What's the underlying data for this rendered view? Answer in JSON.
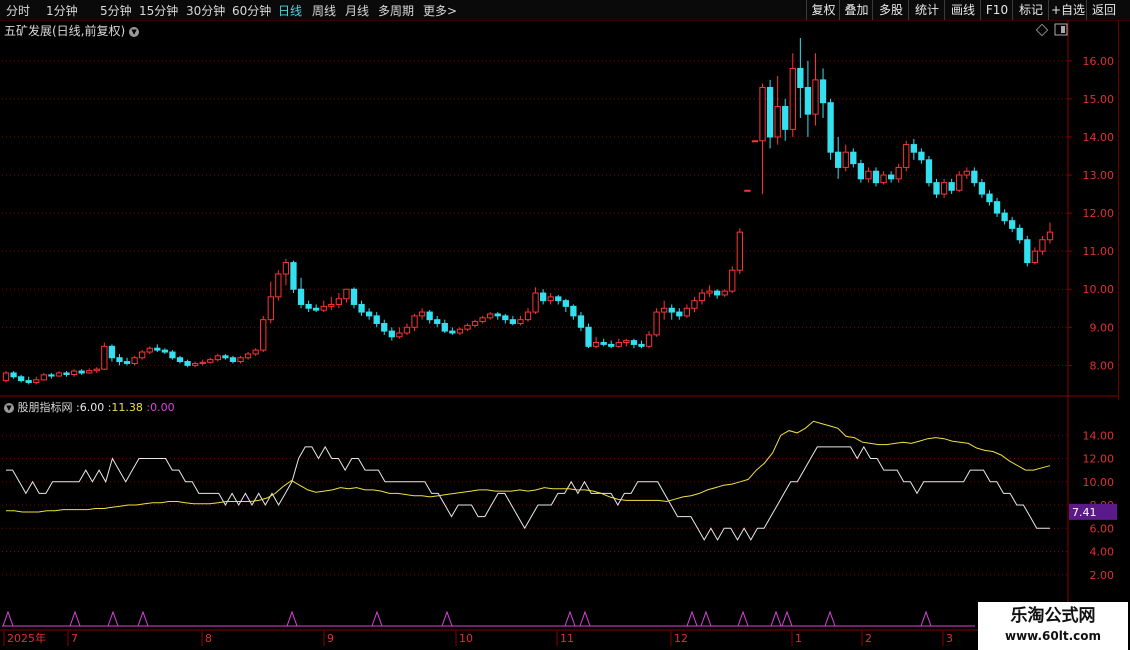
{
  "toolbar": {
    "periods": [
      {
        "label": "分时",
        "active": false
      },
      {
        "label": "1分钟",
        "active": false
      },
      {
        "label": "5分钟",
        "active": false
      },
      {
        "label": "15分钟",
        "active": false
      },
      {
        "label": "30分钟",
        "active": false
      },
      {
        "label": "60分钟",
        "active": false
      },
      {
        "label": "日线",
        "active": true
      },
      {
        "label": "周线",
        "active": false
      },
      {
        "label": "月线",
        "active": false
      },
      {
        "label": "多周期",
        "active": false
      },
      {
        "label": "更多",
        "active": false
      }
    ],
    "more_arrow": ">",
    "right_buttons": [
      "复权",
      "叠加",
      "多股",
      "统计",
      "画线",
      "F10",
      "标记",
      "+自选",
      "返回"
    ]
  },
  "chart_title": "五矿发展(日线,前复权)",
  "main_axis_labels": [
    "16.00",
    "15.00",
    "14.00",
    "13.00",
    "12.00",
    "11.00",
    "10.00",
    "9.00",
    "8.00"
  ],
  "indicator": {
    "name": "股朋指标网",
    "values": [
      ":6.00",
      ":11.38",
      ":0.00"
    ],
    "axis_labels": [
      "14.00",
      "12.00",
      "10.00",
      "8.00",
      "6.00",
      "4.00",
      "2.00"
    ],
    "current_marker": "7.41"
  },
  "date_axis": {
    "labels": [
      "2025年",
      "7",
      "8",
      "9",
      "10",
      "11",
      "12",
      "1",
      "2",
      "3"
    ]
  },
  "watermark": {
    "line1": "乐淘公式网",
    "line2": "www.60lt.com"
  },
  "colors": {
    "up": "#ff3333",
    "down": "#33e0f0",
    "yellow": "#f0e040",
    "white": "#e8e8e8",
    "magenta": "#e040e0",
    "grid": "#8a0000",
    "marker_bg": "#5a1a8a"
  },
  "chart_data": {
    "type": "line",
    "title": "五矿发展(日线,前复权)",
    "candles": [
      [
        7.6,
        7.8,
        7.55,
        7.85
      ],
      [
        7.8,
        7.7,
        7.65,
        7.85
      ],
      [
        7.7,
        7.6,
        7.55,
        7.75
      ],
      [
        7.6,
        7.55,
        7.5,
        7.7
      ],
      [
        7.55,
        7.62,
        7.5,
        7.7
      ],
      [
        7.62,
        7.75,
        7.6,
        7.8
      ],
      [
        7.75,
        7.72,
        7.65,
        7.8
      ],
      [
        7.72,
        7.8,
        7.7,
        7.85
      ],
      [
        7.8,
        7.76,
        7.7,
        7.85
      ],
      [
        7.76,
        7.85,
        7.7,
        7.9
      ],
      [
        7.85,
        7.8,
        7.75,
        7.9
      ],
      [
        7.8,
        7.86,
        7.78,
        7.92
      ],
      [
        7.86,
        7.9,
        7.8,
        7.95
      ],
      [
        7.9,
        8.5,
        7.88,
        8.6
      ],
      [
        8.5,
        8.2,
        8.1,
        8.55
      ],
      [
        8.2,
        8.1,
        8.0,
        8.3
      ],
      [
        8.1,
        8.05,
        8.0,
        8.2
      ],
      [
        8.05,
        8.2,
        8.0,
        8.25
      ],
      [
        8.2,
        8.35,
        8.15,
        8.4
      ],
      [
        8.35,
        8.45,
        8.3,
        8.5
      ],
      [
        8.45,
        8.4,
        8.35,
        8.55
      ],
      [
        8.4,
        8.35,
        8.3,
        8.45
      ],
      [
        8.35,
        8.2,
        8.15,
        8.4
      ],
      [
        8.2,
        8.1,
        8.05,
        8.25
      ],
      [
        8.1,
        8.0,
        7.95,
        8.15
      ],
      [
        8.0,
        8.05,
        7.95,
        8.1
      ],
      [
        8.05,
        8.08,
        8.0,
        8.15
      ],
      [
        8.08,
        8.15,
        8.05,
        8.2
      ],
      [
        8.15,
        8.25,
        8.1,
        8.3
      ],
      [
        8.25,
        8.2,
        8.15,
        8.3
      ],
      [
        8.2,
        8.1,
        8.05,
        8.25
      ],
      [
        8.1,
        8.2,
        8.05,
        8.25
      ],
      [
        8.2,
        8.3,
        8.15,
        8.35
      ],
      [
        8.3,
        8.4,
        8.25,
        8.45
      ],
      [
        8.4,
        9.2,
        8.35,
        9.3
      ],
      [
        9.2,
        9.8,
        9.1,
        10.2
      ],
      [
        9.8,
        10.4,
        9.7,
        10.5
      ],
      [
        10.4,
        10.7,
        10.1,
        10.8
      ],
      [
        10.7,
        10.0,
        9.9,
        10.75
      ],
      [
        10.0,
        9.6,
        9.5,
        10.3
      ],
      [
        9.6,
        9.5,
        9.4,
        9.7
      ],
      [
        9.5,
        9.45,
        9.4,
        9.6
      ],
      [
        9.45,
        9.55,
        9.4,
        9.7
      ],
      [
        9.55,
        9.6,
        9.45,
        9.8
      ],
      [
        9.6,
        9.75,
        9.5,
        9.9
      ],
      [
        9.75,
        10.0,
        9.65,
        10.0
      ],
      [
        10.0,
        9.6,
        9.5,
        10.05
      ],
      [
        9.6,
        9.4,
        9.3,
        9.7
      ],
      [
        9.4,
        9.3,
        9.2,
        9.5
      ],
      [
        9.3,
        9.1,
        9.0,
        9.4
      ],
      [
        9.1,
        8.9,
        8.8,
        9.2
      ],
      [
        8.9,
        8.75,
        8.65,
        9.0
      ],
      [
        8.75,
        8.85,
        8.7,
        9.0
      ],
      [
        8.85,
        9.0,
        8.8,
        9.1
      ],
      [
        9.0,
        9.3,
        8.9,
        9.35
      ],
      [
        9.3,
        9.4,
        9.2,
        9.5
      ],
      [
        9.4,
        9.2,
        9.1,
        9.45
      ],
      [
        9.2,
        9.1,
        9.0,
        9.3
      ],
      [
        9.1,
        8.9,
        8.85,
        9.2
      ],
      [
        8.9,
        8.85,
        8.8,
        9.0
      ],
      [
        8.85,
        8.95,
        8.8,
        9.0
      ],
      [
        8.95,
        9.05,
        8.9,
        9.1
      ],
      [
        9.05,
        9.15,
        9.0,
        9.2
      ],
      [
        9.15,
        9.25,
        9.1,
        9.3
      ],
      [
        9.25,
        9.35,
        9.2,
        9.4
      ],
      [
        9.35,
        9.3,
        9.2,
        9.4
      ],
      [
        9.3,
        9.2,
        9.1,
        9.35
      ],
      [
        9.2,
        9.1,
        9.05,
        9.3
      ],
      [
        9.1,
        9.2,
        9.05,
        9.3
      ],
      [
        9.2,
        9.4,
        9.15,
        9.5
      ],
      [
        9.4,
        9.9,
        9.35,
        10.05
      ],
      [
        9.9,
        9.7,
        9.6,
        10.0
      ],
      [
        9.7,
        9.8,
        9.6,
        9.9
      ],
      [
        9.8,
        9.7,
        9.6,
        9.85
      ],
      [
        9.7,
        9.55,
        9.4,
        9.75
      ],
      [
        9.55,
        9.3,
        9.2,
        9.6
      ],
      [
        9.3,
        9.0,
        8.9,
        9.4
      ],
      [
        9.0,
        8.5,
        8.45,
        9.1
      ],
      [
        8.5,
        8.6,
        8.45,
        8.75
      ],
      [
        8.6,
        8.55,
        8.5,
        8.7
      ],
      [
        8.55,
        8.5,
        8.45,
        8.65
      ],
      [
        8.5,
        8.6,
        8.45,
        8.7
      ],
      [
        8.6,
        8.65,
        8.5,
        8.7
      ],
      [
        8.65,
        8.55,
        8.45,
        8.7
      ],
      [
        8.55,
        8.5,
        8.45,
        8.65
      ],
      [
        8.5,
        8.8,
        8.45,
        8.9
      ],
      [
        8.8,
        9.4,
        8.75,
        9.5
      ],
      [
        9.4,
        9.5,
        9.2,
        9.7
      ],
      [
        9.5,
        9.4,
        9.2,
        9.6
      ],
      [
        9.4,
        9.3,
        9.2,
        9.5
      ],
      [
        9.3,
        9.5,
        9.25,
        9.6
      ],
      [
        9.5,
        9.7,
        9.4,
        9.8
      ],
      [
        9.7,
        9.9,
        9.6,
        10.0
      ],
      [
        9.9,
        9.95,
        9.8,
        10.1
      ],
      [
        9.95,
        9.85,
        9.75,
        10.0
      ],
      [
        9.85,
        9.95,
        9.8,
        10.0
      ],
      [
        9.95,
        10.5,
        9.9,
        10.6
      ],
      [
        10.5,
        11.5,
        10.4,
        11.6
      ],
      [
        12.6,
        12.6,
        12.6,
        12.6
      ],
      [
        13.9,
        13.9,
        13.9,
        13.9
      ],
      [
        13.9,
        15.3,
        12.5,
        15.4
      ],
      [
        15.3,
        14.0,
        13.7,
        15.5
      ],
      [
        14.0,
        14.8,
        13.8,
        15.6
      ],
      [
        14.8,
        14.2,
        13.9,
        15.0
      ],
      [
        14.2,
        15.8,
        14.0,
        16.2
      ],
      [
        15.8,
        15.3,
        14.5,
        16.6
      ],
      [
        15.3,
        14.6,
        14.0,
        16.0
      ],
      [
        14.6,
        15.5,
        14.3,
        16.2
      ],
      [
        15.5,
        14.9,
        14.5,
        15.8
      ],
      [
        14.9,
        13.6,
        13.4,
        15.0
      ],
      [
        13.6,
        13.2,
        12.9,
        14.0
      ],
      [
        13.2,
        13.6,
        13.1,
        13.8
      ],
      [
        13.6,
        13.3,
        13.2,
        13.7
      ],
      [
        13.3,
        12.9,
        12.8,
        13.4
      ],
      [
        12.9,
        13.1,
        12.8,
        13.2
      ],
      [
        13.1,
        12.8,
        12.7,
        13.2
      ],
      [
        12.8,
        13.0,
        12.75,
        13.1
      ],
      [
        13.0,
        12.9,
        12.8,
        13.1
      ],
      [
        12.9,
        13.2,
        12.8,
        13.3
      ],
      [
        13.2,
        13.8,
        13.1,
        13.9
      ],
      [
        13.8,
        13.6,
        13.4,
        13.95
      ],
      [
        13.6,
        13.4,
        13.3,
        13.7
      ],
      [
        13.4,
        12.8,
        12.7,
        13.5
      ],
      [
        12.8,
        12.5,
        12.4,
        12.9
      ],
      [
        12.5,
        12.8,
        12.4,
        12.9
      ],
      [
        12.8,
        12.6,
        12.5,
        12.9
      ],
      [
        12.6,
        13.0,
        12.55,
        13.1
      ],
      [
        13.0,
        13.1,
        12.9,
        13.2
      ],
      [
        13.1,
        12.8,
        12.7,
        13.2
      ],
      [
        12.8,
        12.5,
        12.4,
        12.9
      ],
      [
        12.5,
        12.3,
        12.2,
        12.6
      ],
      [
        12.3,
        12.0,
        11.9,
        12.4
      ],
      [
        12.0,
        11.8,
        11.7,
        12.1
      ],
      [
        11.8,
        11.6,
        11.5,
        11.9
      ],
      [
        11.6,
        11.3,
        11.2,
        11.7
      ],
      [
        11.3,
        10.7,
        10.6,
        11.4
      ],
      [
        10.7,
        11.0,
        10.65,
        11.1
      ],
      [
        11.0,
        11.3,
        10.9,
        11.4
      ],
      [
        11.3,
        11.5,
        11.2,
        11.75
      ]
    ],
    "ylim": [
      7.3,
      16.6
    ],
    "indicator_series": [
      {
        "values": [
          11,
          11,
          10,
          9,
          10,
          9,
          9,
          10,
          10,
          10,
          10,
          10,
          11,
          10,
          11,
          10,
          12,
          11,
          10,
          11,
          12,
          12,
          12,
          12,
          12,
          11,
          11,
          10,
          10,
          9,
          9,
          9,
          9,
          8,
          9,
          8,
          9,
          8,
          9,
          8,
          9,
          8,
          9,
          10,
          12,
          13,
          13,
          12,
          13,
          12,
          12,
          11,
          12,
          12,
          11,
          11,
          11,
          10,
          10,
          10,
          10,
          10,
          10,
          10,
          9,
          9,
          8,
          7,
          8,
          8,
          8,
          7,
          7,
          8,
          9,
          9,
          8,
          7,
          6,
          7,
          8,
          8,
          8,
          9,
          9,
          10,
          9,
          10,
          9,
          9,
          9,
          9,
          8,
          9,
          9,
          10,
          10,
          10,
          10,
          9,
          8,
          7,
          7,
          7,
          6,
          5,
          6,
          5,
          6,
          6,
          5,
          6,
          5,
          6,
          6,
          7,
          8,
          9,
          10,
          10,
          11,
          12,
          13,
          13,
          13,
          13,
          13,
          13,
          12,
          13,
          12,
          12,
          11,
          11,
          11,
          10,
          10,
          9,
          10,
          10,
          10,
          10,
          10,
          10,
          10,
          11,
          11,
          11,
          10,
          10,
          9,
          9,
          8,
          8,
          7,
          6,
          6,
          6
        ]
      },
      {
        "values": [
          7.5,
          7.5,
          7.4,
          7.4,
          7.4,
          7.5,
          7.5,
          7.6,
          7.6,
          7.6,
          7.6,
          7.7,
          7.7,
          7.8,
          7.9,
          8.0,
          8.0,
          8.1,
          8.2,
          8.2,
          8.3,
          8.3,
          8.2,
          8.1,
          8.1,
          8.1,
          8.2,
          8.3,
          8.3,
          8.3,
          8.3,
          8.4,
          8.6,
          9.0,
          9.6,
          10.1,
          9.7,
          9.3,
          9.1,
          9.2,
          9.3,
          9.5,
          9.4,
          9.5,
          9.3,
          9.3,
          9.2,
          9.0,
          9.0,
          8.9,
          8.8,
          8.8,
          8.7,
          8.8,
          8.9,
          9.0,
          9.1,
          9.2,
          9.3,
          9.3,
          9.2,
          9.2,
          9.2,
          9.3,
          9.2,
          9.3,
          9.5,
          9.4,
          9.4,
          9.4,
          9.3,
          9.3,
          9.2,
          9.0,
          8.7,
          8.5,
          8.4,
          8.4,
          8.4,
          8.4,
          8.4,
          8.3,
          8.5,
          8.7,
          8.8,
          9.0,
          9.3,
          9.5,
          9.7,
          9.8,
          10.0,
          10.2,
          11.0,
          11.6,
          12.5,
          14.0,
          14.4,
          14.2,
          14.6,
          15.2,
          15.0,
          14.8,
          14.6,
          13.9,
          13.8,
          13.4,
          13.3,
          13.2,
          13.2,
          13.3,
          13.4,
          13.3,
          13.5,
          13.7,
          13.8,
          13.7,
          13.5,
          13.4,
          13.3,
          12.9,
          12.7,
          12.6,
          12.3,
          11.8,
          11.4,
          11.0,
          11.0,
          11.2,
          11.38
        ]
      },
      {
        "values": [
          0,
          0,
          0,
          0,
          0,
          0,
          0,
          0,
          0,
          0,
          0,
          0,
          0,
          0,
          0,
          0,
          0,
          0,
          0,
          0,
          0,
          0,
          0,
          0,
          0,
          0,
          0,
          0,
          0,
          0
        ]
      }
    ],
    "indicator_ylim": [
      0,
      16
    ],
    "x_ticks": [
      "2025年",
      "7",
      "8",
      "9",
      "10",
      "11",
      "12",
      "1",
      "2",
      "3"
    ]
  }
}
